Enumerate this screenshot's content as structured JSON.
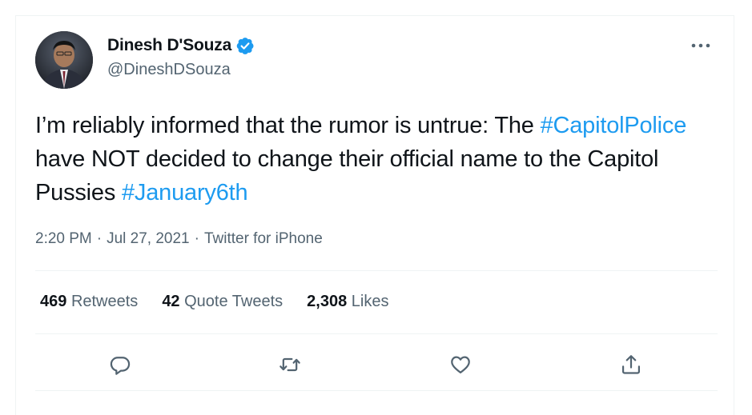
{
  "author": {
    "display_name": "Dinesh D'Souza",
    "handle": "@DineshDSouza",
    "verified": true
  },
  "tweet": {
    "text_1": "I’m reliably informed that the rumor is untrue: The ",
    "hashtag_1": "#CapitolPolice",
    "text_2": " have NOT decided to change their official name to the Capitol Pussies ",
    "hashtag_2": "#January6th"
  },
  "meta": {
    "time": "2:20 PM",
    "separator": "·",
    "date": "Jul 27, 2021",
    "source": "Twitter for iPhone"
  },
  "stats": {
    "retweets_count": "469",
    "retweets_label": "Retweets",
    "quotes_count": "42",
    "quotes_label": "Quote Tweets",
    "likes_count": "2,308",
    "likes_label": "Likes"
  },
  "icons": {
    "more": "more-horizontal-icon",
    "reply": "reply-icon",
    "retweet": "retweet-icon",
    "like": "heart-icon",
    "share": "share-icon",
    "verified": "verified-badge-icon"
  },
  "colors": {
    "link": "#1d9bf0",
    "text": "#0f1419",
    "secondary": "#536471",
    "border": "#eff3f4"
  }
}
